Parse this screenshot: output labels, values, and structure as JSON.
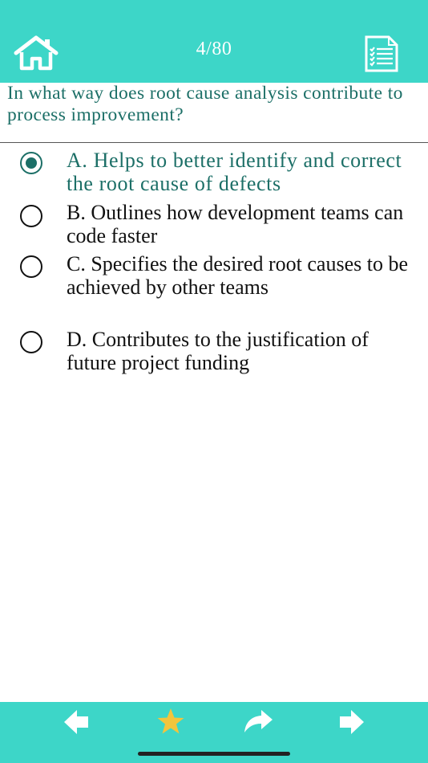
{
  "header": {
    "counter": "4/80",
    "home_icon": "home-icon",
    "list_icon": "question-list-icon",
    "bg_color": "#3dd6c8"
  },
  "question": {
    "text": "In what way does root cause analysis contribute to process improvement?"
  },
  "options": [
    {
      "text": "A. Helps to better identify and correct the root cause of defects",
      "selected": true
    },
    {
      "text": "B. Outlines how development teams can code faster",
      "selected": false
    },
    {
      "text": "C. Specifies the desired root causes to be achieved by other teams",
      "selected": false
    },
    {
      "text": "D. Contributes to the justification of future project funding",
      "selected": false
    }
  ],
  "footer": {
    "icons": [
      "back-arrow-icon",
      "star-icon",
      "share-icon",
      "forward-arrow-icon"
    ],
    "star_color": "#f2c53d"
  },
  "colors": {
    "accent": "#3dd6c8",
    "selected_text": "#1c6f67"
  }
}
